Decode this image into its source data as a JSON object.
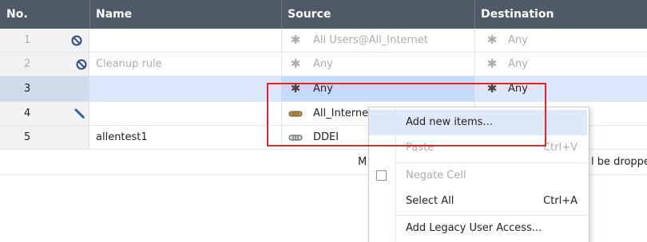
{
  "columns": {
    "no": "No.",
    "name": "Name",
    "source": "Source",
    "destination": "Destination"
  },
  "rows": [
    {
      "no": "1",
      "name": "",
      "source": "All Users@All_Internet",
      "destination": "Any",
      "icon": "block-icon",
      "style": "disabled"
    },
    {
      "no": "2",
      "name": "Cleanup rule",
      "source": "Any",
      "destination": "Any",
      "icon": "block-icon",
      "style": "disabled"
    },
    {
      "no": "3",
      "name": "",
      "source": "Any",
      "destination": "Any",
      "icon": "",
      "style": "selected"
    },
    {
      "no": "4",
      "name": "",
      "source": "All_Interne",
      "destination": "",
      "icon": "pencil-icon",
      "style": "normal"
    },
    {
      "no": "5",
      "name": "allentest1",
      "source": "DDEI",
      "destination": "",
      "icon": "",
      "style": "normal"
    }
  ],
  "footer": {
    "left_fragment": "M",
    "right_fragment": "l be droppe"
  },
  "context_menu": {
    "items": [
      {
        "label": "Add new items...",
        "shortcut": "",
        "state": "highlighted"
      },
      {
        "label": "Paste",
        "shortcut": "Ctrl+V",
        "state": "disabled"
      },
      {
        "label": "Negate Cell",
        "shortcut": "",
        "state": "disabled",
        "checkbox": true
      },
      {
        "label": "Select All",
        "shortcut": "Ctrl+A",
        "state": "enabled"
      },
      {
        "label": "Add Legacy User Access...",
        "shortcut": "",
        "state": "enabled"
      }
    ]
  },
  "colors": {
    "header_bg": "#4e5a66",
    "selected_row": "#dbe8fb",
    "highlight_border": "#e0242a",
    "menu_highlight": "#dde9f8"
  }
}
